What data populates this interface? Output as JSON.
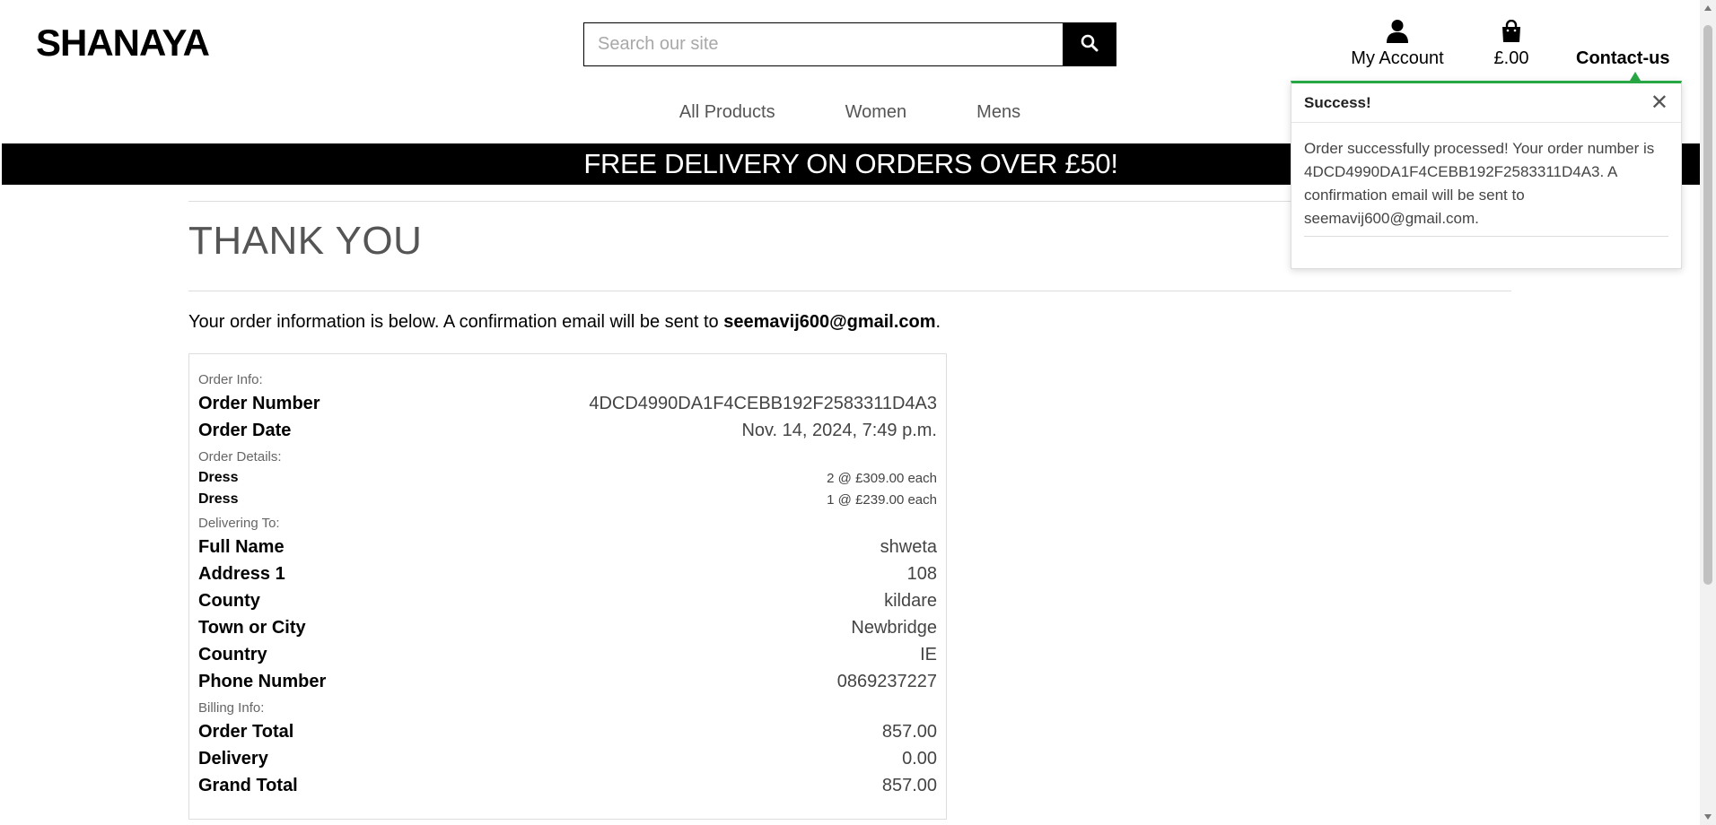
{
  "header": {
    "brand": "SHANAYA",
    "search_placeholder": "Search our site",
    "account_label": "My Account",
    "bag_total": "£.00",
    "contact_label": "Contact-us"
  },
  "nav": {
    "items": [
      {
        "label": "All Products"
      },
      {
        "label": "Women"
      },
      {
        "label": "Mens"
      }
    ]
  },
  "banner": {
    "text": "FREE DELIVERY ON ORDERS OVER £50!"
  },
  "page": {
    "title": "THANK YOU",
    "info_prefix": "Your order information is below. A confirmation email will be sent to ",
    "email": "seemavij600@gmail.com",
    "info_suffix": "."
  },
  "order": {
    "order_info_label": "Order Info:",
    "order_number_label": "Order Number",
    "order_number": "4DCD4990DA1F4CEBB192F2583311D4A3",
    "order_date_label": "Order Date",
    "order_date": "Nov. 14, 2024, 7:49 p.m.",
    "order_details_label": "Order Details:",
    "items": [
      {
        "name": "Dress",
        "qty_price": "2 @ £309.00 each"
      },
      {
        "name": "Dress",
        "qty_price": "1 @ £239.00 each"
      }
    ],
    "delivering_label": "Delivering To:",
    "delivery": [
      {
        "label": "Full Name",
        "value": "shweta"
      },
      {
        "label": "Address 1",
        "value": "108"
      },
      {
        "label": "County",
        "value": "kildare"
      },
      {
        "label": "Town or City",
        "value": "Newbridge"
      },
      {
        "label": "Country",
        "value": "IE"
      },
      {
        "label": "Phone Number",
        "value": "0869237227"
      }
    ],
    "billing_label": "Billing Info:",
    "billing": [
      {
        "label": "Order Total",
        "value": "857.00"
      },
      {
        "label": "Delivery",
        "value": "0.00"
      },
      {
        "label": "Grand Total",
        "value": "857.00"
      }
    ]
  },
  "toast": {
    "title": "Success!",
    "close": "✕",
    "message": "Order successfully processed! Your order number is 4DCD4990DA1F4CEBB192F2583311D4A3. A confirmation email will be sent to seemavij600@gmail.com.",
    "accent_color": "#28a745"
  },
  "icons": {
    "search": "search-icon",
    "account": "user-icon",
    "bag": "shopping-bag-icon",
    "close": "close-icon"
  }
}
